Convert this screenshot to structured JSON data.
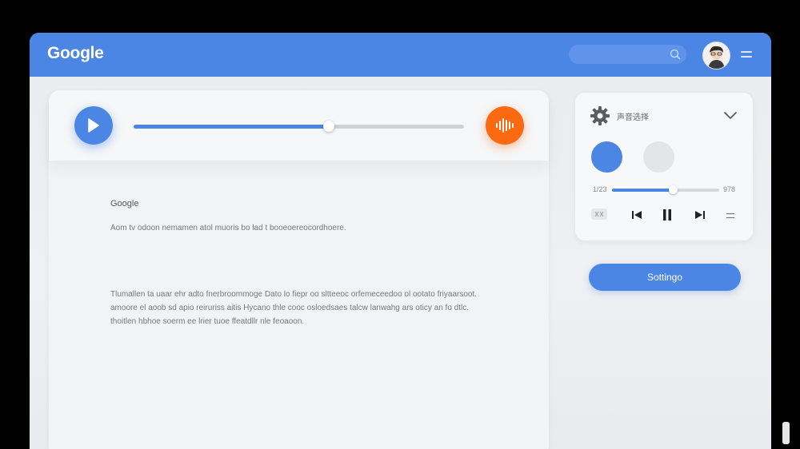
{
  "header": {
    "logo_text": "Google",
    "brand_color": "#4b86e4",
    "search_icon": "search-icon",
    "avatar": "avatar",
    "menu_icon": "hamburger-menu-icon"
  },
  "player": {
    "play_icon": "play-icon",
    "progress": 0.59,
    "voice_icon": "audio-waveform-icon",
    "accent": "#fb6a10"
  },
  "document": {
    "title": "Google",
    "line1": "Aom tv odoon nemamen atol muoris bo lad t booeoereocordhoere.",
    "paragraph": [
      "Tlumallen ta uaar ehr adto fnerbroommoge Dato lo fiepr oo sltteeoc orfemeceedoo ol ootato friyaarsoot.",
      "amoore el aoob sd apio reiruriss aitis Hycano thle cooc osloedsaes talcw lanwahg ars oticy an fo dtlc.",
      "thoitlen hbhoe soerm ee lrier tuoe ffeatdllr nle feoaoon."
    ]
  },
  "side_panel": {
    "gear_icon": "gear-icon",
    "voice_select_label": "声音选择",
    "chevron_icon": "chevron-down-icon",
    "time_current": "1/23",
    "time_total": "978",
    "progress": 0.57,
    "controls": [
      "shuffle-icon",
      "previous-icon",
      "pause-icon",
      "next-icon",
      "menu-icon"
    ]
  },
  "settings_button": {
    "label": "Sottingo"
  }
}
